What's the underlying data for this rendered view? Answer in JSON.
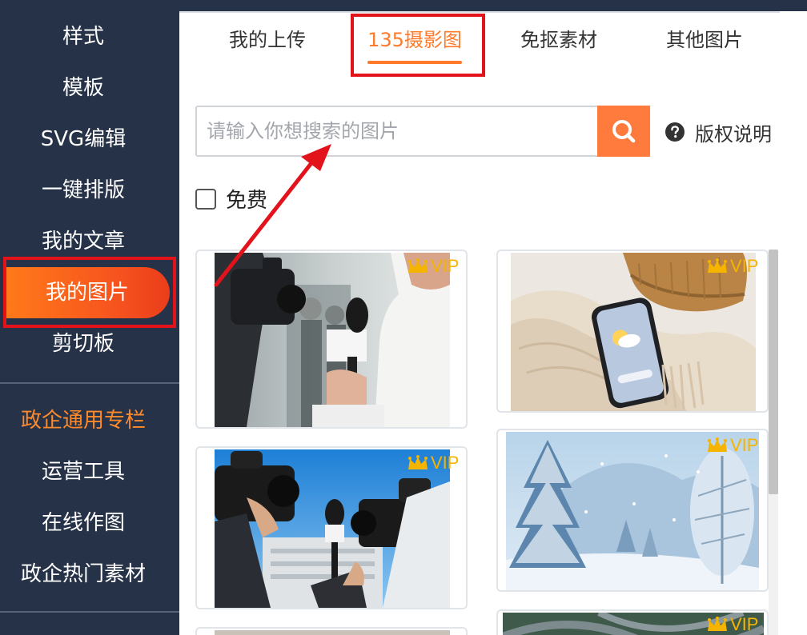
{
  "sidebar": {
    "items": [
      {
        "label": "样式"
      },
      {
        "label": "模板"
      },
      {
        "label": "SVG编辑"
      },
      {
        "label": "一键排版"
      },
      {
        "label": "我的文章"
      },
      {
        "label": "我的图片",
        "active": true
      },
      {
        "label": "剪切板"
      }
    ],
    "section_title": "政企通用专栏",
    "section_items": [
      {
        "label": "运营工具"
      },
      {
        "label": "在线作图"
      },
      {
        "label": "政企热门素材"
      }
    ]
  },
  "tabs": [
    {
      "label": "我的上传"
    },
    {
      "label": "135摄影图",
      "active": true
    },
    {
      "label": "免抠素材"
    },
    {
      "label": "其他图片"
    }
  ],
  "search": {
    "placeholder": "请输入你想搜索的图片",
    "button_icon": "search-icon"
  },
  "copyright": {
    "icon": "question-circle-icon",
    "label": "版权说明"
  },
  "filter": {
    "free_label": "免费",
    "free_checked": false
  },
  "images": [
    {
      "description_icon": "press-interview-photo",
      "badge": "VIP"
    },
    {
      "description_icon": "phone-on-knit-scarf-photo",
      "badge": "VIP"
    },
    {
      "description_icon": "camera-crew-photo",
      "badge": "VIP"
    },
    {
      "description_icon": "snowy-pine-forest-photo",
      "badge": "VIP"
    },
    {
      "description_icon": "image-partial",
      "badge": ""
    },
    {
      "description_icon": "highway-interchange-photo",
      "badge": "VIP"
    }
  ],
  "colors": {
    "sidebar_bg": "#263247",
    "accent": "#ff7a2b",
    "active_gradient_start": "#ff7a1a",
    "active_gradient_end": "#ea3d1b",
    "vip_gold": "#f5b400",
    "annotation_red": "#e3131b"
  }
}
